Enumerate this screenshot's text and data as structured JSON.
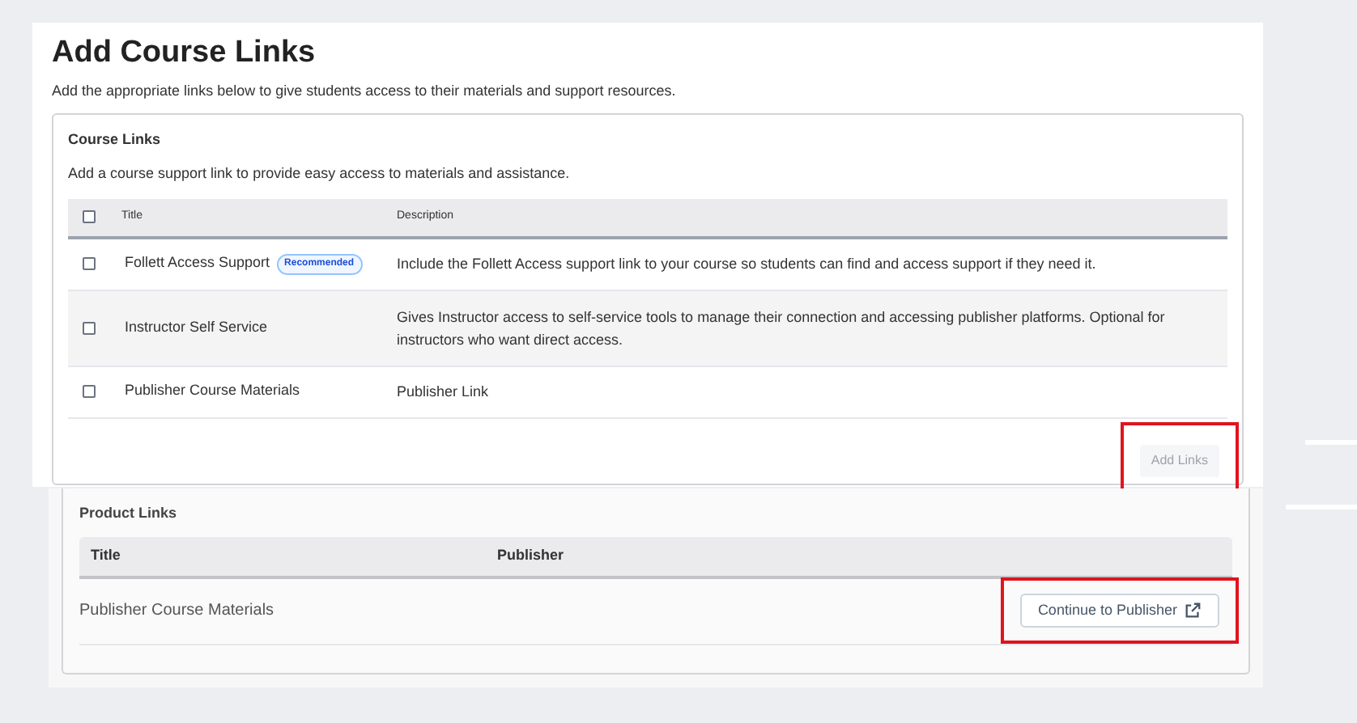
{
  "title": "Add Course Links",
  "subtitle": "Add the appropriate links below to give students access to their materials and support resources.",
  "course_links": {
    "heading": "Course Links",
    "description": "Add a course support link to provide easy access to materials and assistance.",
    "columns": [
      "Title",
      "Description"
    ],
    "select_all": {
      "checked": false
    },
    "rows": [
      {
        "title": "Follett Access Support",
        "badge": "Recommended",
        "description": "Include the Follett Access support link to your course so students can find and access support if they need it.",
        "checked": false
      },
      {
        "title": "Instructor Self Service",
        "description": "Gives Instructor access to self-service tools to manage their connection and accessing publisher platforms. Optional for instructors who want direct access.",
        "checked": false
      },
      {
        "title": "Publisher Course Materials",
        "description": "Publisher Link",
        "checked": false
      }
    ],
    "button": {
      "label": "Add Links",
      "disabled": true,
      "highlighted": true
    }
  },
  "product_links": {
    "heading": "Product Links",
    "columns": [
      "Title",
      "Publisher"
    ],
    "rows": [
      {
        "title": "Publisher Course Materials",
        "button": {
          "label": "Continue to Publisher",
          "highlighted": true
        }
      }
    ]
  }
}
